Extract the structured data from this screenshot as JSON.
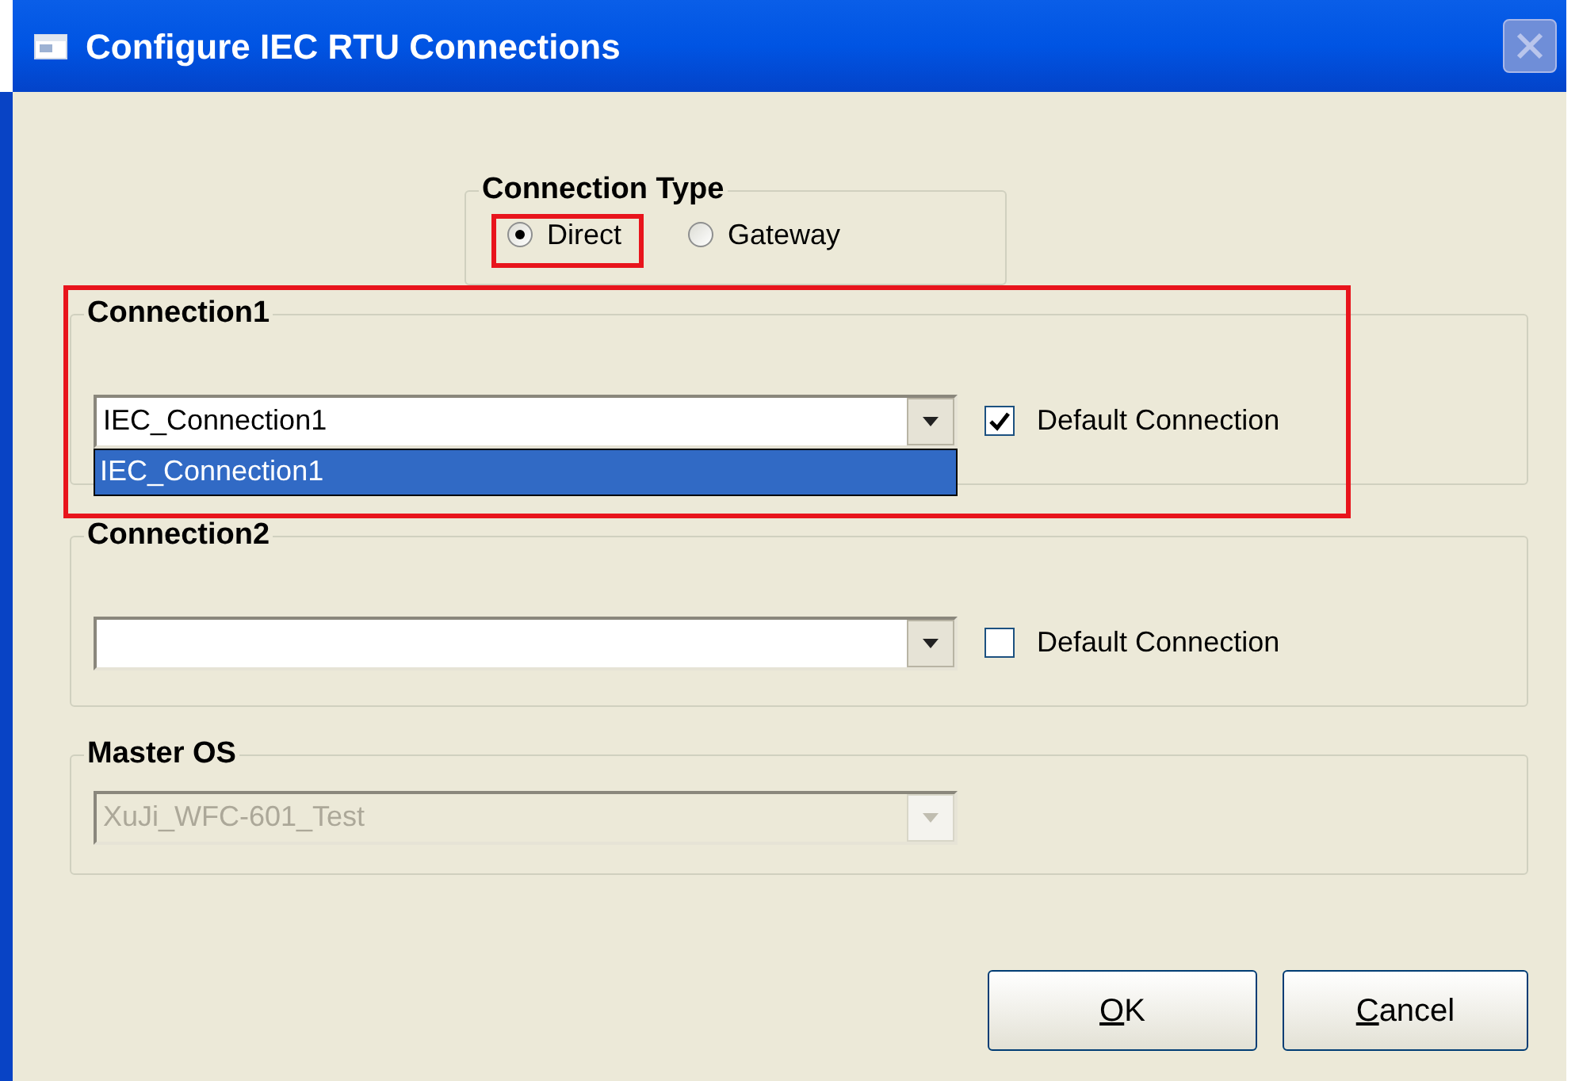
{
  "window": {
    "title": "Configure IEC RTU Connections",
    "close_disabled": true
  },
  "connection_type": {
    "title": "Connection Type",
    "options": [
      {
        "label": "Direct",
        "selected": true
      },
      {
        "label": "Gateway",
        "selected": false
      }
    ]
  },
  "connections": [
    {
      "title": "Connection1",
      "value": "IEC_Connection1",
      "checkbox": {
        "label": "Default Connection",
        "checked": true
      },
      "dropdown_list": [
        {
          "label": "IEC_Connection1",
          "selected": true
        }
      ]
    },
    {
      "title": "Connection2",
      "checkbox": {
        "label": "Default Connection",
        "checked": false
      }
    }
  ],
  "master_os": {
    "title": "Master OS",
    "value": "XuJi_WFC-601_Test",
    "disabled": true
  },
  "buttons": [
    {
      "access_key": "O",
      "rest": "K"
    },
    {
      "access_key": "C",
      "rest": "ancel"
    }
  ]
}
